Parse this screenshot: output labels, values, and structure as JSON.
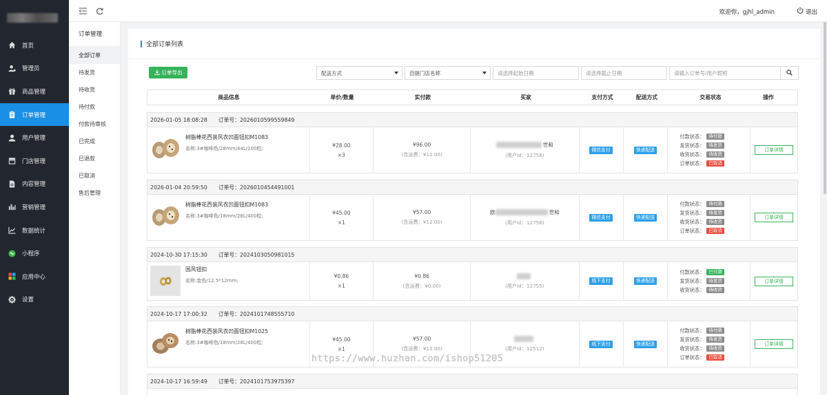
{
  "sidebar": {
    "items": [
      {
        "label": "首页",
        "icon": "home-icon"
      },
      {
        "label": "管理员",
        "icon": "admin-icon"
      },
      {
        "label": "商品管理",
        "icon": "gift-icon"
      },
      {
        "label": "订单管理",
        "icon": "clipboard-icon"
      },
      {
        "label": "用户管理",
        "icon": "user-icon"
      },
      {
        "label": "门店管理",
        "icon": "store-icon"
      },
      {
        "label": "内容管理",
        "icon": "document-icon"
      },
      {
        "label": "营销管理",
        "icon": "bar-chart-icon"
      },
      {
        "label": "数据统计",
        "icon": "line-chart-icon"
      },
      {
        "label": "小程序",
        "icon": "mini-program-icon"
      },
      {
        "label": "应用中心",
        "icon": "apps-icon"
      },
      {
        "label": "设置",
        "icon": "gear-icon"
      }
    ],
    "active_index": 3
  },
  "topbar": {
    "welcome": "欢迎你，gjhl_admin",
    "logout": "退出"
  },
  "subnav": {
    "title": "订单管理",
    "items": [
      "全部订单",
      "待发货",
      "待收货",
      "待付款",
      "付款待审核",
      "已完成",
      "已退款",
      "已取消",
      "售后管理"
    ],
    "active_index": 0
  },
  "content": {
    "title": "全部订单列表",
    "export_label": "订单导出",
    "filters": {
      "ship_method": "配送方式",
      "store": "自提门店名称",
      "start_placeholder": "请选择起始日期",
      "end_placeholder": "请选择截止日期",
      "keyword_placeholder": "请输入订单号/用户昵称"
    },
    "columns": [
      "商品信息",
      "单价/数量",
      "实付款",
      "买家",
      "支付方式",
      "配送方式",
      "交易状态",
      "操作"
    ]
  },
  "orders": [
    {
      "time": "2026-01-05 18:08:28",
      "order_no_label": "订单号：2026010599559849",
      "goods_name": "树脂棒花西装风衣凹面钮扣M1083",
      "goods_spec": "名称:3#咖啡色/28mm/44L/100粒;",
      "price": "¥28.00",
      "qty": "×3",
      "paid": "¥96.00",
      "freight": "(含运费：¥12.00)",
      "buyer_suffix": "世和",
      "user_id": "(用户id：12758)",
      "pay_method": "微信支付",
      "ship_method": "快递配送",
      "statuses": [
        {
          "label": "付款状态：",
          "value": "待付款",
          "color": "gray"
        },
        {
          "label": "发货状态：",
          "value": "待发货",
          "color": "gray"
        },
        {
          "label": "收货状态：",
          "value": "待收货",
          "color": "gray"
        },
        {
          "label": "订单状态：",
          "value": "已取消",
          "color": "red"
        }
      ],
      "action": "订单详情"
    },
    {
      "time": "2026-01-04 20:59:50",
      "order_no_label": "订单号：2026010454491001",
      "goods_name": "树脂棒花西装风衣凹面钮扣M1083",
      "goods_spec": "名称:3#咖啡色/18mm/28L/400粒;",
      "price": "¥45.00",
      "qty": "×1",
      "paid": "¥57.00",
      "freight": "(含运费：¥12.00)",
      "buyer_prefix": "欧",
      "buyer_suffix": "世和",
      "user_id": "(用户id：12758)",
      "pay_method": "微信支付",
      "ship_method": "快递配送",
      "statuses": [
        {
          "label": "付款状态：",
          "value": "待付款",
          "color": "gray"
        },
        {
          "label": "发货状态：",
          "value": "待发货",
          "color": "gray"
        },
        {
          "label": "收货状态：",
          "value": "待收货",
          "color": "gray"
        },
        {
          "label": "订单状态：",
          "value": "已取消",
          "color": "red"
        }
      ],
      "action": "订单详情"
    },
    {
      "time": "2024-10-30 17:15:30",
      "order_no_label": "订单号：2024103050981015",
      "goods_name": "国风钮扣",
      "goods_spec": "名称:金色/12.5*12mm;",
      "price": "¥0.86",
      "qty": "×1",
      "paid": "¥0.86",
      "freight": "(含运费：¥0.00)",
      "user_id": "(用户id：12755)",
      "pay_method": "线下支付",
      "ship_method": "快递配送",
      "statuses": [
        {
          "label": "付款状态：",
          "value": "已付款",
          "color": "green"
        },
        {
          "label": "发货状态：",
          "value": "待发货",
          "color": "gray"
        },
        {
          "label": "收货状态：",
          "value": "待收货",
          "color": "gray"
        }
      ],
      "action": "订单详情"
    },
    {
      "time": "2024-10-17 17:00:32",
      "order_no_label": "订单号：2024101748555710",
      "goods_name": "树脂棒花西装风衣凹面钮扣M1025",
      "goods_spec": "名称:3#咖啡色/18mm/28L/400粒;",
      "price": "¥45.00",
      "qty": "×1",
      "paid": "¥57.00",
      "freight": "(含运费：¥12.00)",
      "user_id": "(用户id：12512)",
      "pay_method": "线下支付",
      "ship_method": "快递配送",
      "statuses": [
        {
          "label": "付款状态：",
          "value": "待付款",
          "color": "gray"
        },
        {
          "label": "发货状态：",
          "value": "待发货",
          "color": "gray"
        },
        {
          "label": "收货状态：",
          "value": "待收货",
          "color": "gray"
        },
        {
          "label": "订单状态：",
          "value": "已取消",
          "color": "red"
        }
      ],
      "action": "订单详情"
    },
    {
      "time": "2024-10-17 16:59:49",
      "order_no_label": "订单号：2024101753975397"
    }
  ],
  "watermark": "https://www.huzhan.com/ishop51205"
}
